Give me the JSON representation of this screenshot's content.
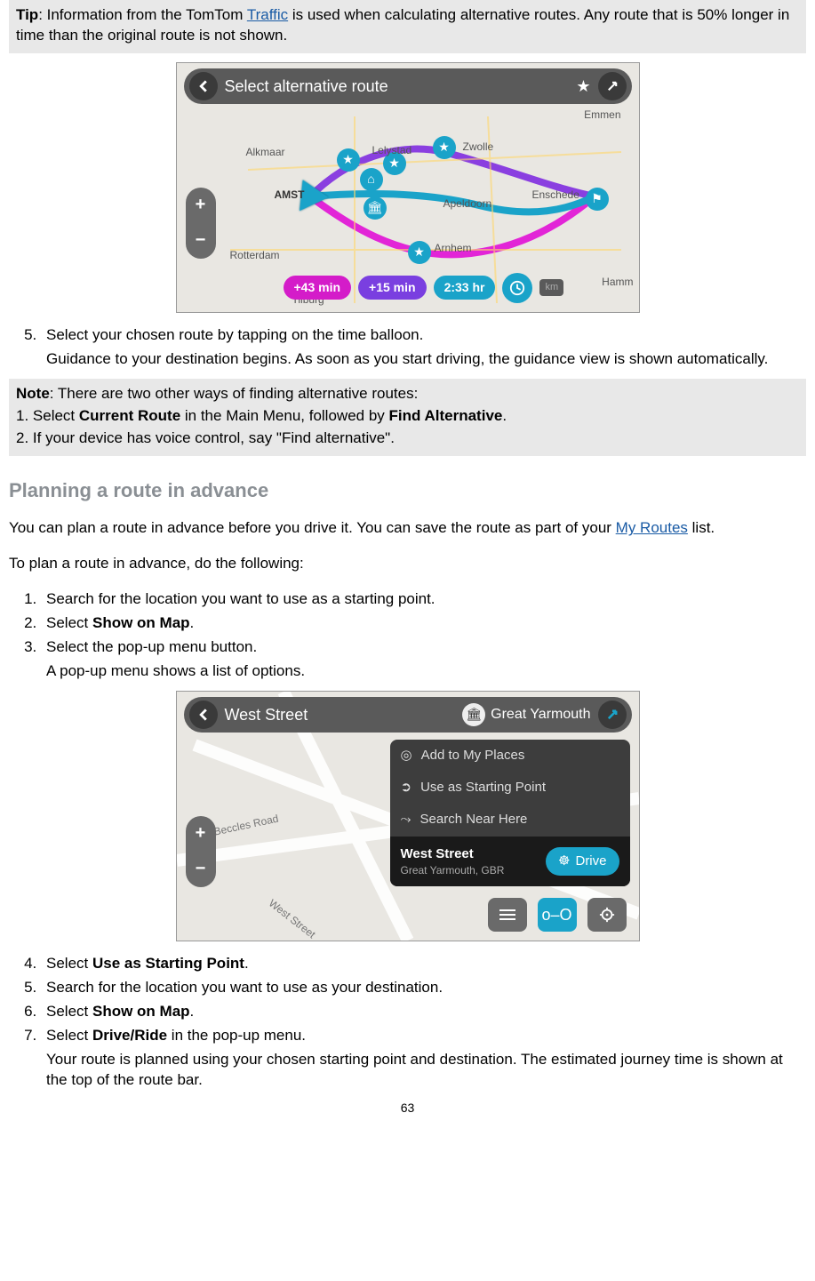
{
  "tip": {
    "label": "Tip",
    "text_before": ": Information from the TomTom ",
    "link": "Traffic",
    "text_after": " is used when calculating alternative routes. Any route that is 50% longer in time than the original route is not shown."
  },
  "fig1": {
    "title": "Select alternative route",
    "zoom_plus": "+",
    "zoom_minus": "−",
    "labels": {
      "emmen": "Emmen",
      "alkmaar": "Alkmaar",
      "lelystad": "Lelystad",
      "zwolle": "Zwolle",
      "amst": "AMST",
      "apeldoorn": "Apeldoorn",
      "enschede": "Enschede",
      "rotterdam": "Rotterdam",
      "arnhem": "Arnhem",
      "tilburg": "Tilburg",
      "hamm": "Hamm"
    },
    "pills": {
      "p1": "+43 min",
      "p2": "+15 min",
      "p3": "2:33 hr"
    },
    "km": "km"
  },
  "step5": {
    "num": "5.",
    "line1": "Select your chosen route by tapping on the time balloon.",
    "line2": "Guidance to your destination begins. As soon as you start driving, the guidance view is shown automatically."
  },
  "note": {
    "label": "Note",
    "intro": ": There are two other ways of finding alternative routes:",
    "item1_pre": "1. Select ",
    "item1_b1": "Current Route",
    "item1_mid": " in the Main Menu, followed by ",
    "item1_b2": "Find Alternative",
    "item1_post": ".",
    "item2": "2. If your device has voice control, say \"Find alternative\"."
  },
  "section_title": "Planning a route in advance",
  "intro": {
    "text_before": "You can plan a route in advance before you drive it. You can save the route as part of your ",
    "link": "My Routes",
    "text_after": " list."
  },
  "intro2": "To plan a route in advance, do the following:",
  "list": {
    "i1": "Search for the location you want to use as a starting point.",
    "i2_pre": "Select ",
    "i2_b": "Show on Map",
    "i2_post": ".",
    "i3a": "Select the pop-up menu button.",
    "i3b": "A pop-up menu shows a list of options."
  },
  "fig2": {
    "left_title": "West Street",
    "right_title": "Great Yarmouth",
    "menu": {
      "m1": "Add to My Places",
      "m2": "Use as Starting Point",
      "m3": "Search Near Here",
      "sel_title": "West Street",
      "sel_sub": "Great Yarmouth, GBR",
      "drive": "Drive"
    },
    "zoom_plus": "+",
    "zoom_minus": "−",
    "roads": {
      "r1": "Beccles Road",
      "r2": "West Street"
    }
  },
  "list2": {
    "i4_pre": "Select ",
    "i4_b": "Use as Starting Point",
    "i4_post": ".",
    "i5": "Search for the location you want to use as your destination.",
    "i6_pre": "Select ",
    "i6_b": "Show on Map",
    "i6_post": ".",
    "i7_pre": "Select ",
    "i7_b": "Drive/Ride",
    "i7_post": " in the pop-up menu.",
    "i7_body": "Your route is planned using your chosen starting point and destination. The estimated journey time is shown at the top of the route bar."
  },
  "page_number": "63"
}
